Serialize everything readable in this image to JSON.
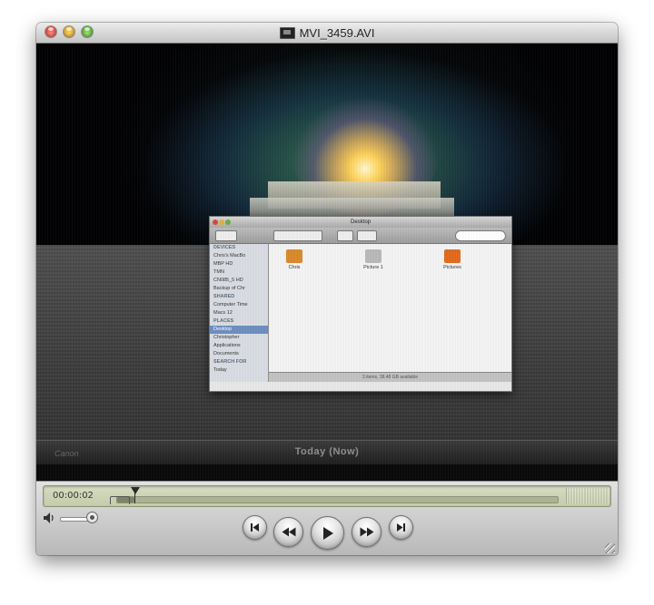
{
  "window": {
    "title": "MVI_3459.AVI"
  },
  "video_frame": {
    "monitor_status_text": "Today (Now)",
    "monitor_brand": "Canon",
    "finder_window": {
      "title": "Desktop",
      "sidebar": [
        {
          "label": "DEVICES",
          "heading": true
        },
        {
          "label": "Chris's MacBo"
        },
        {
          "label": "MBP HD"
        },
        {
          "label": "TMN"
        },
        {
          "label": "CN085_5 HD"
        },
        {
          "label": "Backup of Chr"
        },
        {
          "label": "SHARED",
          "heading": true
        },
        {
          "label": "Computer Time"
        },
        {
          "label": "Macs 12"
        },
        {
          "label": "PLACES",
          "heading": true
        },
        {
          "label": "Desktop",
          "selected": true
        },
        {
          "label": "Christopher"
        },
        {
          "label": "Applications"
        },
        {
          "label": "Documents"
        },
        {
          "label": "SEARCH FOR",
          "heading": true
        },
        {
          "label": "Today"
        }
      ],
      "items": [
        {
          "label": "Chris",
          "color": "#d98a2b"
        },
        {
          "label": "Picture 1",
          "color": "#b9b9b9"
        },
        {
          "label": "Pictures",
          "color": "#e26a1e"
        }
      ],
      "status": "3 items, 38.48 GB available"
    }
  },
  "controls": {
    "timecode": "00:00:02",
    "playback_progress": 0.04,
    "volume_level": 0.9,
    "buttons": [
      {
        "name": "go-to-start",
        "icon": "skip-back-icon"
      },
      {
        "name": "rewind",
        "icon": "rewind-icon"
      },
      {
        "name": "play",
        "icon": "play-icon"
      },
      {
        "name": "fast-forward",
        "icon": "fast-forward-icon"
      },
      {
        "name": "go-to-end",
        "icon": "skip-forward-icon"
      }
    ]
  },
  "colors": {
    "scrubber_bg": "#c8cfb0",
    "button_face": "#e4e4e4",
    "titlebar": "#d6d6d6"
  }
}
